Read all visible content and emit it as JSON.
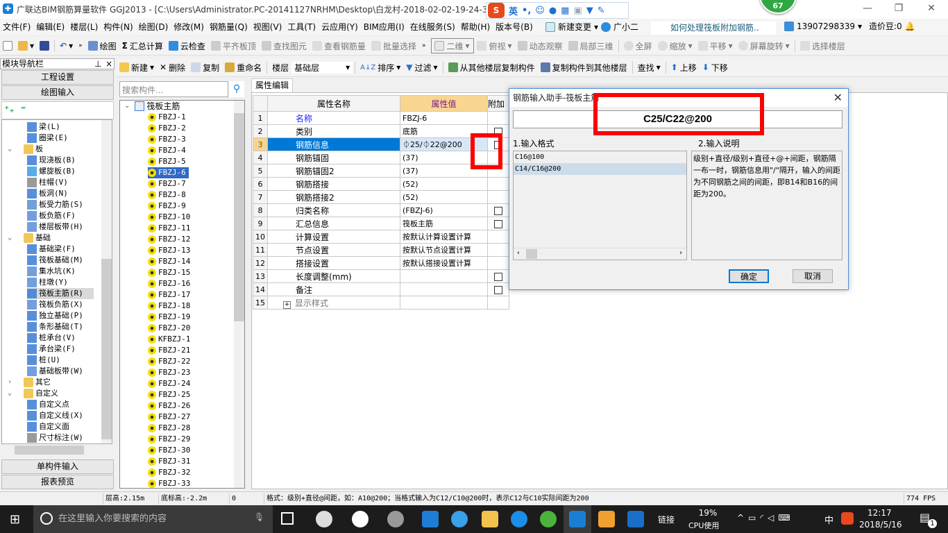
{
  "title": "广联达BIM钢筋算量软件 GGJ2013 - [C:\\Users\\Administrator.PC-20141127NRHM\\Desktop\\白龙村-2018-02-02-19-24-35",
  "ime": {
    "lang": "英",
    "punct": "•,"
  },
  "badge": "67",
  "menu": [
    "文件(F)",
    "编辑(E)",
    "楼层(L)",
    "构件(N)",
    "绘图(D)",
    "修改(M)",
    "钢筋量(Q)",
    "视图(V)",
    "工具(T)",
    "云应用(Y)",
    "BIM应用(I)",
    "在线服务(S)",
    "帮助(H)",
    "版本号(B)"
  ],
  "menu_extra": {
    "new_change": "新建变更",
    "assistant": "广小二",
    "tip": "如何处理筏板附加钢筋..",
    "user": "13907298339",
    "beans": "造价豆:0"
  },
  "toolbar1": {
    "draw": "绘图",
    "sum": "汇总计算",
    "cloud_check": "云检查",
    "align_top": "平齐板顶",
    "find": "查找图元",
    "view_rebar": "查看钢筋量",
    "batch": "批量选择",
    "view_mode": "二维",
    "top_view": "俯视",
    "dynamic": "动态观察",
    "local3d": "局部三维",
    "fullscreen": "全屏",
    "zoom": "缩放",
    "pan": "平移",
    "rotate": "屏幕旋转",
    "select_floor": "选择楼层"
  },
  "toolbar2": {
    "new": "新建",
    "delete": "删除",
    "copy": "复制",
    "rename": "重命名",
    "floor_label": "楼层",
    "floor": "基础层",
    "sort": "排序",
    "filter": "过滤",
    "copy_from": "从其他楼层复制构件",
    "copy_to": "复制构件到其他楼层",
    "find": "查找",
    "up": "上移",
    "down": "下移"
  },
  "nav": {
    "title": "模块导航栏",
    "project_settings": "工程设置",
    "drawing_input": "绘图输入",
    "single_input": "单构件输入",
    "report_preview": "报表预览"
  },
  "left_tree": [
    {
      "label": "梁(L)",
      "level": 2,
      "color": "#3a7bd5"
    },
    {
      "label": "圈梁(E)",
      "level": 2,
      "color": "#3a7bd5"
    },
    {
      "label": "板",
      "level": 1,
      "folder": true,
      "open": true
    },
    {
      "label": "现浇板(B)",
      "level": 2,
      "color": "#3a7bd5"
    },
    {
      "label": "螺旋板(B)",
      "level": 2,
      "color": "#3a9fe0"
    },
    {
      "label": "柱帽(V)",
      "level": 2,
      "color": "#888"
    },
    {
      "label": "板洞(N)",
      "level": 2,
      "color": "#3a7bd5"
    },
    {
      "label": "板受力筋(S)",
      "level": 2,
      "color": "#5b8fd6"
    },
    {
      "label": "板负筋(F)",
      "level": 2,
      "color": "#5b8fd6"
    },
    {
      "label": "楼层板带(H)",
      "level": 2,
      "color": "#5b8fd6"
    },
    {
      "label": "基础",
      "level": 1,
      "folder": true,
      "open": true
    },
    {
      "label": "基础梁(F)",
      "level": 2,
      "color": "#3a7bd5"
    },
    {
      "label": "筏板基础(M)",
      "level": 2,
      "color": "#3a7bd5"
    },
    {
      "label": "集水坑(K)",
      "level": 2,
      "color": "#5b8fd6"
    },
    {
      "label": "柱墩(Y)",
      "level": 2,
      "color": "#5b8fd6"
    },
    {
      "label": "筏板主筋(R)",
      "level": 2,
      "color": "#3a7bd5",
      "selected": true
    },
    {
      "label": "筏板负筋(X)",
      "level": 2,
      "color": "#5b8fd6"
    },
    {
      "label": "独立基础(P)",
      "level": 2,
      "color": "#3a7bd5"
    },
    {
      "label": "条形基础(T)",
      "level": 2,
      "color": "#3a7bd5"
    },
    {
      "label": "桩承台(V)",
      "level": 2,
      "color": "#3a7bd5"
    },
    {
      "label": "承台梁(F)",
      "level": 2,
      "color": "#3a7bd5"
    },
    {
      "label": "桩(U)",
      "level": 2,
      "color": "#3a7bd5"
    },
    {
      "label": "基础板带(W)",
      "level": 2,
      "color": "#5b8fd6"
    },
    {
      "label": "其它",
      "level": 1,
      "folder": true,
      "open": false
    },
    {
      "label": "自定义",
      "level": 1,
      "folder": true,
      "open": true
    },
    {
      "label": "自定义点",
      "level": 2,
      "color": "#3a7bd5"
    },
    {
      "label": "自定义线(X)",
      "level": 2,
      "color": "#3a7bd5"
    },
    {
      "label": "自定义面",
      "level": 2,
      "color": "#3a7bd5"
    },
    {
      "label": "尺寸标注(W)",
      "level": 2,
      "color": "#888"
    }
  ],
  "search_placeholder": "搜索构件...",
  "mid_tree": {
    "root": "筏板主筋",
    "items": [
      "FBZJ-1",
      "FBZJ-2",
      "FBZJ-3",
      "FBZJ-4",
      "FBZJ-5",
      "FBZJ-6",
      "FBZJ-7",
      "FBZJ-8",
      "FBZJ-9",
      "FBZJ-10",
      "FBZJ-11",
      "FBZJ-12",
      "FBZJ-13",
      "FBZJ-14",
      "FBZJ-15",
      "FBZJ-16",
      "FBZJ-17",
      "FBZJ-18",
      "FBZJ-19",
      "FBZJ-20",
      "KFBZJ-1",
      "FBZJ-21",
      "FBZJ-22",
      "FBZJ-23",
      "FBZJ-24",
      "FBZJ-25",
      "FBZJ-26",
      "FBZJ-27",
      "FBZJ-28",
      "FBZJ-29",
      "FBZJ-30",
      "FBZJ-31",
      "FBZJ-32",
      "FBZJ-33"
    ],
    "selected": "FBZJ-6"
  },
  "props": {
    "tab": "属性编辑",
    "headers": [
      "属性名称",
      "属性值",
      "附加"
    ],
    "rows": [
      {
        "n": "1",
        "name": "名称",
        "value": "FBZJ-6",
        "cb": false,
        "blue": true
      },
      {
        "n": "2",
        "name": "类别",
        "value": "底筋",
        "cb": true
      },
      {
        "n": "3",
        "name": "钢筋信息",
        "value": "⏀25/⏀22@200",
        "cb": true,
        "selected": true
      },
      {
        "n": "4",
        "name": "钢筋锚固",
        "value": "(37)",
        "cb": false
      },
      {
        "n": "5",
        "name": "钢筋锚固2",
        "value": "(37)",
        "cb": false
      },
      {
        "n": "6",
        "name": "钢筋搭接",
        "value": "(52)",
        "cb": false
      },
      {
        "n": "7",
        "name": "钢筋搭接2",
        "value": "(52)",
        "cb": false
      },
      {
        "n": "8",
        "name": "归类名称",
        "value": "(FBZJ-6)",
        "cb": true
      },
      {
        "n": "9",
        "name": "汇总信息",
        "value": "筏板主筋",
        "cb": true
      },
      {
        "n": "10",
        "name": "计算设置",
        "value": "按默认计算设置计算",
        "cb": false
      },
      {
        "n": "11",
        "name": "节点设置",
        "value": "按默认节点设置计算",
        "cb": false
      },
      {
        "n": "12",
        "name": "搭接设置",
        "value": "按默认搭接设置计算",
        "cb": false
      },
      {
        "n": "13",
        "name": "长度调整(mm)",
        "value": "",
        "cb": true
      },
      {
        "n": "14",
        "name": "备注",
        "value": "",
        "cb": true
      },
      {
        "n": "15",
        "name": "显示样式",
        "value": "",
        "cb": false,
        "expand": true
      }
    ]
  },
  "dialog": {
    "title": "钢筋输入助手-筏板主筋",
    "input": "C25/C22@200",
    "format_label": "1.输入格式",
    "desc_label": "2.输入说明",
    "formats": [
      "C16@100",
      "C14/C16@200"
    ],
    "selected_format": "C14/C16@200",
    "description": "级别+直径/级别+直径+@+间距，钢筋隔一布一时，钢筋信息用\"/\"隔开，输入的间距为不同钢筋之间的间距，即B14和B16的间距为200。",
    "ok": "确定",
    "cancel": "取消"
  },
  "status": {
    "floor_height": "层高:2.15m",
    "bottom_elev": "底标高:-2.2m",
    "count": "0",
    "hint": "格式：级别+直径@间距，如：A10@200；当格式输入为C12/C10@200时，表示C12与C10实际间距为200",
    "fps": "774 FPS"
  },
  "taskbar": {
    "search": "在这里输入你要搜索的内容",
    "link": "链接",
    "cpu_pct": "19%",
    "cpu_label": "CPU使用",
    "ime": "中",
    "time": "12:17",
    "date": "2018/5/16",
    "notif": "1"
  }
}
